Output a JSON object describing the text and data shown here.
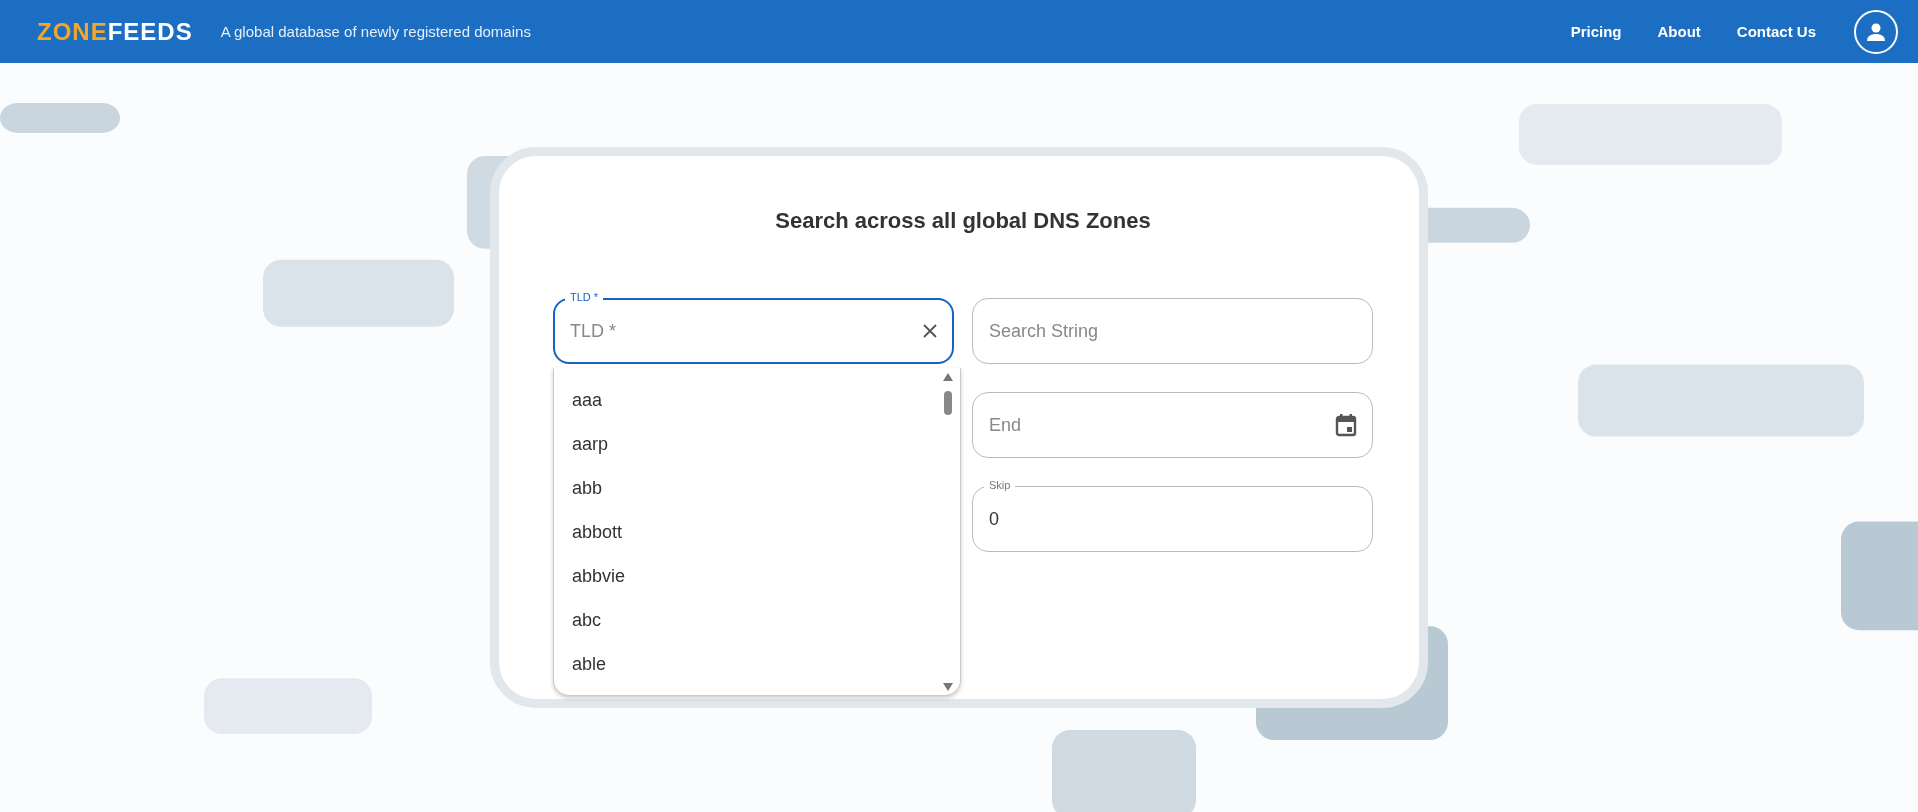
{
  "header": {
    "logo": {
      "first": "ZONE",
      "second": "FEEDS"
    },
    "tagline": "A global database of newly registered domains",
    "nav": [
      "Pricing",
      "About",
      "Contact Us"
    ]
  },
  "search_card": {
    "title": "Search across all global DNS Zones",
    "tld_field": {
      "label": "TLD *",
      "placeholder": "TLD *",
      "focused": true,
      "expanded": true,
      "options": [
        "aaa",
        "aarp",
        "abb",
        "abbott",
        "abbvie",
        "abc",
        "able"
      ]
    },
    "fields": [
      {
        "kind": "text",
        "placeholder": "Search String"
      },
      {
        "kind": "date",
        "placeholder": "End"
      },
      {
        "kind": "number",
        "label": "Skip",
        "value": "0"
      }
    ]
  }
}
